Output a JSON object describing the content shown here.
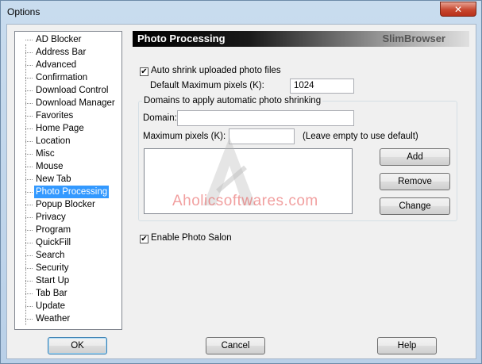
{
  "window": {
    "title": "Options",
    "close_glyph": "✕"
  },
  "sidebar": {
    "items": [
      {
        "label": "AD Blocker"
      },
      {
        "label": "Address Bar"
      },
      {
        "label": "Advanced"
      },
      {
        "label": "Confirmation"
      },
      {
        "label": "Download Control"
      },
      {
        "label": "Download Manager"
      },
      {
        "label": "Favorites"
      },
      {
        "label": "Home Page"
      },
      {
        "label": "Location"
      },
      {
        "label": "Misc"
      },
      {
        "label": "Mouse"
      },
      {
        "label": "New Tab"
      },
      {
        "label": "Photo Processing",
        "selected": true
      },
      {
        "label": "Popup Blocker"
      },
      {
        "label": "Privacy"
      },
      {
        "label": "Program"
      },
      {
        "label": "QuickFill"
      },
      {
        "label": "Search"
      },
      {
        "label": "Security"
      },
      {
        "label": "Start Up"
      },
      {
        "label": "Tab Bar"
      },
      {
        "label": "Update"
      },
      {
        "label": "Weather"
      }
    ]
  },
  "panel": {
    "title": "Photo Processing",
    "brand": "SlimBrowser",
    "auto_shrink": {
      "label": "Auto shrink uploaded photo files",
      "checked": true
    },
    "default_max": {
      "label": "Default Maximum pixels (K):",
      "value": "1024"
    },
    "domains_group": {
      "title": "Domains to apply automatic photo shrinking",
      "domain_label": "Domain:",
      "domain_value": "",
      "max_label": "Maximum pixels (K):",
      "max_value": "",
      "hint": "(Leave empty to use default)",
      "add_label": "Add",
      "remove_label": "Remove",
      "change_label": "Change"
    },
    "photo_salon": {
      "label": "Enable Photo Salon",
      "checked": true
    }
  },
  "footer": {
    "ok_label": "OK",
    "cancel_label": "Cancel",
    "help_label": "Help"
  },
  "watermark": {
    "text": "Aholicsoftwares.com"
  }
}
